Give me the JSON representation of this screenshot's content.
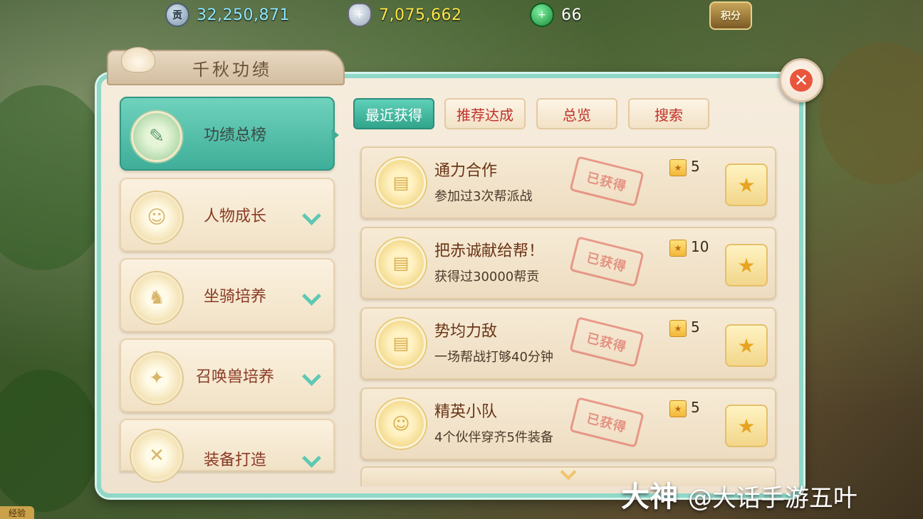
{
  "currencies": {
    "bang_contribution": {
      "icon_text": "贡",
      "value": "32,250,871"
    },
    "silver": {
      "value": "7,075,662"
    },
    "jade": {
      "value": "66"
    },
    "points_label": "积分"
  },
  "panel": {
    "title": "千秋功绩",
    "close_icon": "✕"
  },
  "categories": [
    {
      "label": "功绩总榜",
      "icon": "scroll-icon",
      "active": true
    },
    {
      "label": "人物成长",
      "icon": "character-icon",
      "active": false
    },
    {
      "label": "坐骑培养",
      "icon": "mount-icon",
      "active": false
    },
    {
      "label": "召唤兽培养",
      "icon": "summon-beast-icon",
      "active": false
    },
    {
      "label": "装备打造",
      "icon": "equipment-icon",
      "active": false
    }
  ],
  "tabs": [
    {
      "label": "最近获得",
      "active": true
    },
    {
      "label": "推荐达成",
      "active": false
    },
    {
      "label": "总览",
      "active": false
    },
    {
      "label": "搜索",
      "active": false
    }
  ],
  "achievements": [
    {
      "title": "通力合作",
      "desc": "参加过3次帮派战",
      "points": "5",
      "stamp": "已获得"
    },
    {
      "title": "把赤诚献给帮！",
      "desc": "获得过30000帮贡",
      "points": "10",
      "stamp": "已获得"
    },
    {
      "title": "势均力敌",
      "desc": "一场帮战打够40分钟",
      "points": "5",
      "stamp": "已获得"
    },
    {
      "title": "精英小队",
      "desc": "4个伙伴穿齐5件装备",
      "points": "5",
      "stamp": "已获得"
    }
  ],
  "watermark": {
    "brand": "大神",
    "handle": "@大话手游五叶"
  },
  "exp_label": "经验",
  "colors": {
    "accent": "#3fae98",
    "title_red": "#c0302a",
    "panel_bg": "#f6ecdd"
  }
}
